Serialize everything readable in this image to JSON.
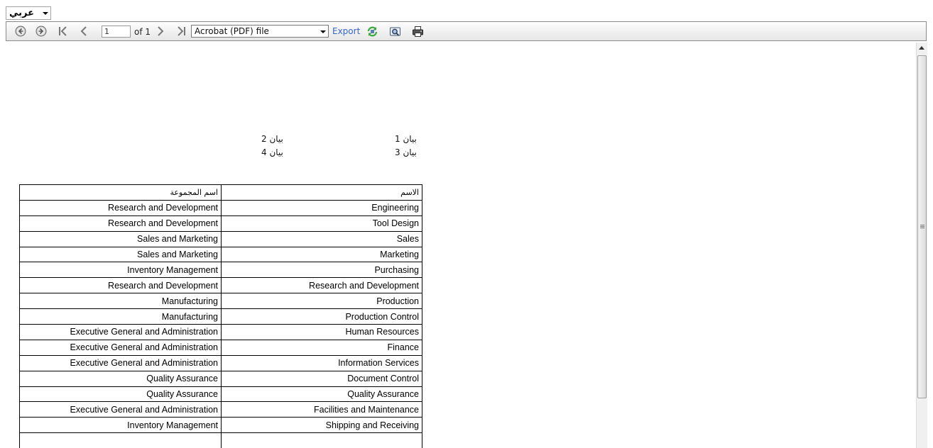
{
  "language": {
    "selected": "عربي"
  },
  "toolbar": {
    "page_current": "1",
    "page_of": "of 1",
    "export_format": "Acrobat (PDF) file",
    "export_label": "Export",
    "icons": {
      "back": "back-arrow-icon",
      "forward": "forward-arrow-icon",
      "first": "first-page-icon",
      "prev": "previous-page-icon",
      "next": "next-page-icon",
      "last": "last-page-icon",
      "refresh": "refresh-icon",
      "zoom": "zoom-icon",
      "print": "print-icon"
    }
  },
  "report": {
    "params": {
      "p1": "بيان 1",
      "p2": "بيان 2",
      "p3": "بيان 3",
      "p4": "بيان 4"
    },
    "headers": {
      "group_name": "اسم المجموعة",
      "name": "الاسم"
    },
    "rows": [
      {
        "group": "Research and Development",
        "name": "Engineering"
      },
      {
        "group": "Research and Development",
        "name": "Tool Design"
      },
      {
        "group": "Sales and Marketing",
        "name": "Sales"
      },
      {
        "group": "Sales and Marketing",
        "name": "Marketing"
      },
      {
        "group": "Inventory Management",
        "name": "Purchasing"
      },
      {
        "group": "Research and Development",
        "name": "Research and Development"
      },
      {
        "group": "Manufacturing",
        "name": "Production"
      },
      {
        "group": "Manufacturing",
        "name": "Production Control"
      },
      {
        "group": "Executive General and Administration",
        "name": "Human Resources"
      },
      {
        "group": "Executive General and Administration",
        "name": "Finance"
      },
      {
        "group": "Executive General and Administration",
        "name": "Information Services"
      },
      {
        "group": "Quality Assurance",
        "name": "Document Control"
      },
      {
        "group": "Quality Assurance",
        "name": "Quality Assurance"
      },
      {
        "group": "Executive General and Administration",
        "name": "Facilities and Maintenance"
      },
      {
        "group": "Inventory Management",
        "name": "Shipping and Receiving"
      },
      {
        "group": "",
        "name": ""
      }
    ]
  }
}
